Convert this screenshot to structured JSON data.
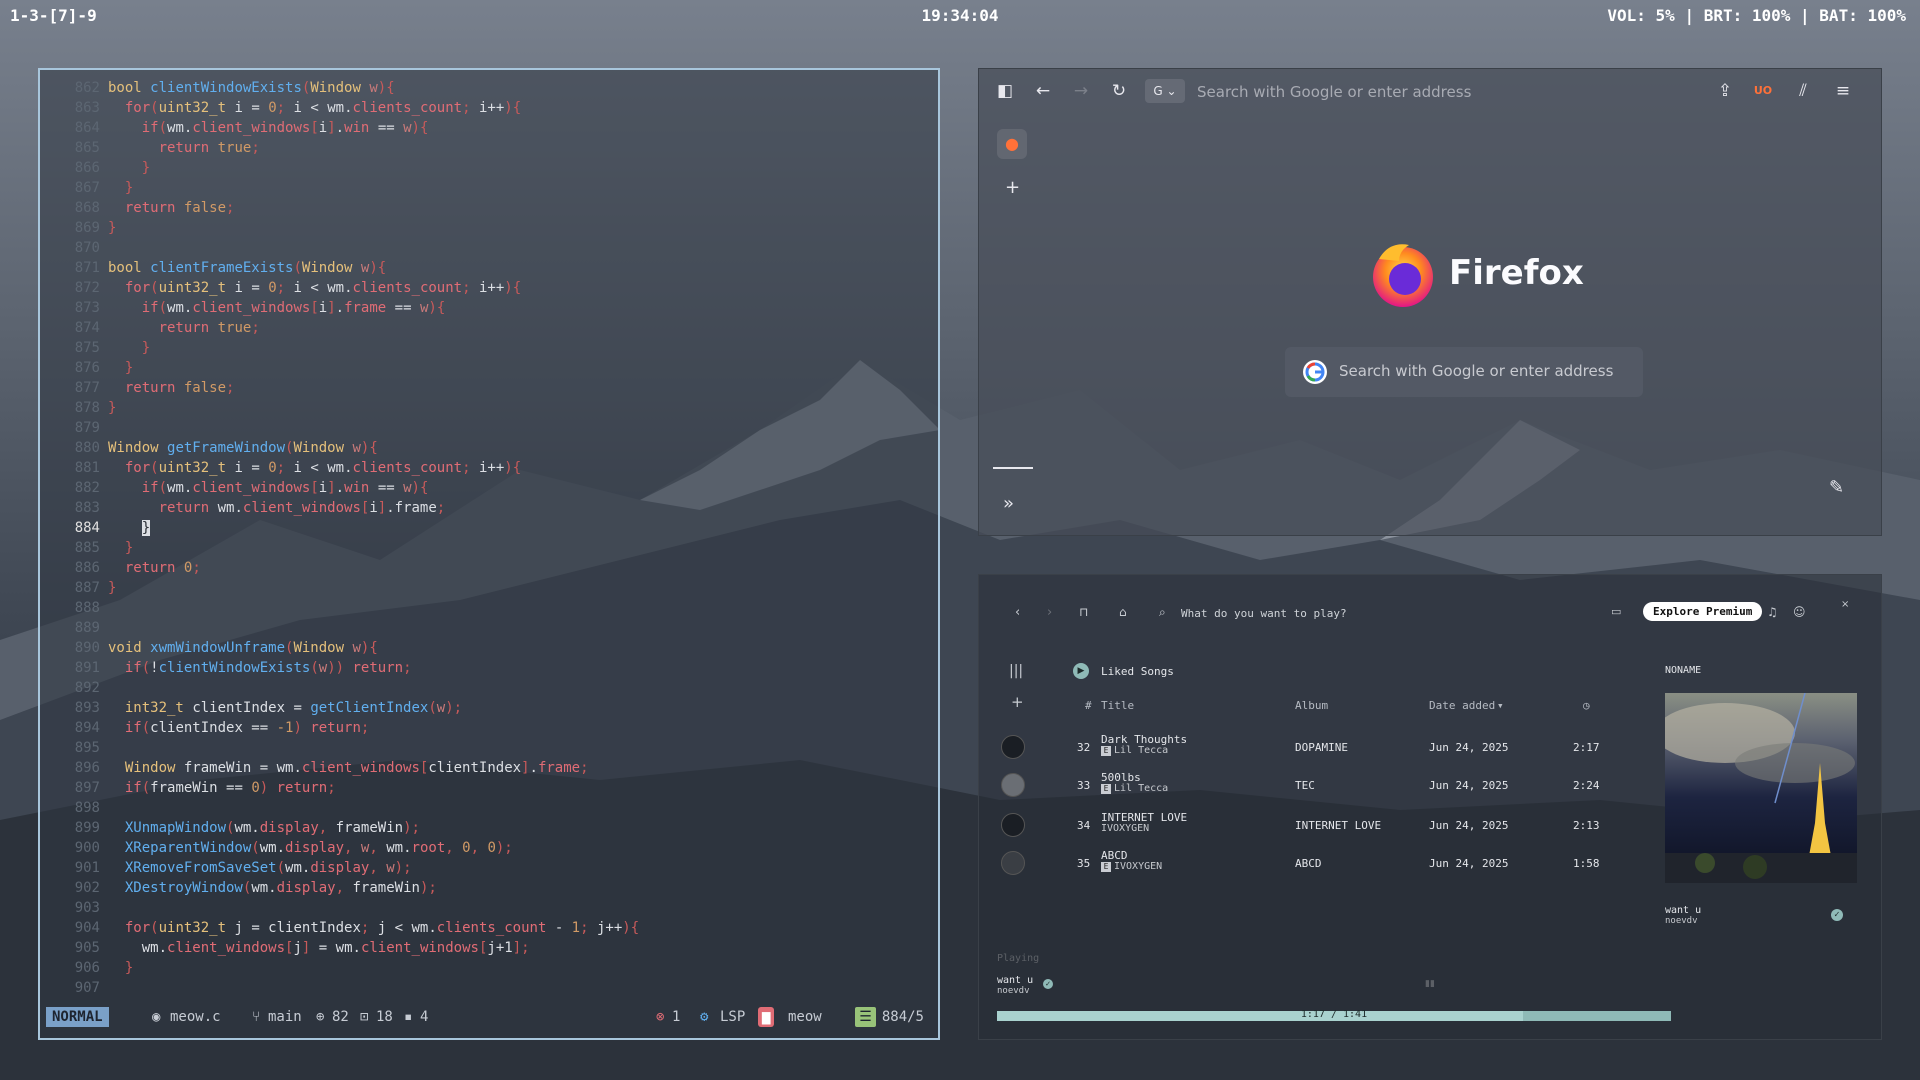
{
  "topbar": {
    "workspaces": "1-3-[7]-9",
    "clock": "19:34:04",
    "status": "VOL: 5% | BRT: 100% | BAT: 100%"
  },
  "editor": {
    "current_line_number": "884",
    "status": {
      "mode": "NORMAL",
      "file": "meow.c",
      "branch": "main",
      "stat_a": "82",
      "stat_b": "18",
      "stat_c": "4",
      "errors": "1",
      "lsp": "LSP",
      "lsp_name": "meow",
      "position": "884/5"
    }
  },
  "firefox": {
    "url_placeholder": "Search with Google or enter address",
    "brand": "Firefox",
    "search_placeholder": "Search with Google or enter address",
    "icons": [
      "sidebar-icon",
      "back-icon",
      "forward-icon",
      "reload-icon",
      "google-icon",
      "extensions-icon",
      "ublock-icon",
      "library-icon",
      "menu-icon",
      "firefox-view-icon",
      "plus-icon",
      "expand-icon",
      "edit-icon"
    ]
  },
  "spotify": {
    "search_placeholder": "What do you want to play?",
    "premium_button": "Explore Premium",
    "playlist_title": "Liked Songs",
    "panel_title": "NONAME",
    "columns": {
      "num": "#",
      "title": "Title",
      "album": "Album",
      "date": "Date added"
    },
    "tracks": [
      {
        "num": "32",
        "title": "Dark Thoughts",
        "artist": "Lil Tecca",
        "album": "DOPAMINE",
        "date": "Jun 24, 2025",
        "duration": "2:17",
        "explicit": "E"
      },
      {
        "num": "33",
        "title": "500lbs",
        "artist": "Lil Tecca",
        "album": "TEC",
        "date": "Jun 24, 2025",
        "duration": "2:24",
        "explicit": "E"
      },
      {
        "num": "34",
        "title": "INTERNET LOVE",
        "artist": "IVOXYGEN",
        "album": "INTERNET LOVE",
        "date": "Jun 24, 2025",
        "duration": "2:13",
        "explicit": ""
      },
      {
        "num": "35",
        "title": "ABCD",
        "artist": "IVOXYGEN",
        "album": "ABCD",
        "date": "Jun 24, 2025",
        "duration": "1:58",
        "explicit": "E"
      }
    ],
    "now_playing_title": "want u",
    "now_playing_artist": "noevdv",
    "panel_song_title": "want u",
    "panel_song_artist": "noevdv",
    "playing_label": "Playing",
    "progress_text": "1:17 / 1:41",
    "progress_fraction": 0.78
  }
}
